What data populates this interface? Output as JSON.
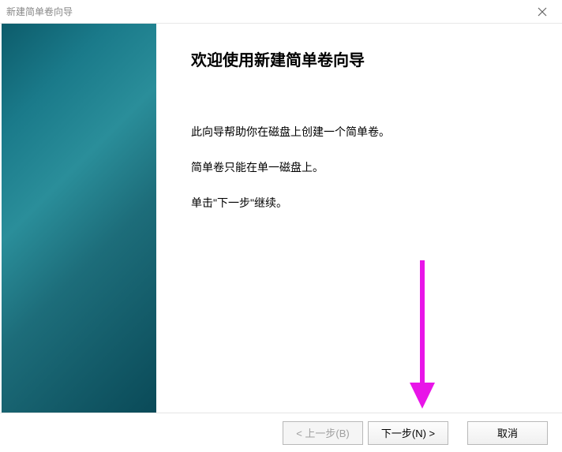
{
  "window": {
    "title": "新建简单卷向导"
  },
  "wizard": {
    "heading": "欢迎使用新建简单卷向导",
    "line1": "此向导帮助你在磁盘上创建一个简单卷。",
    "line2": "简单卷只能在单一磁盘上。",
    "line3": "单击\"下一步\"继续。"
  },
  "buttons": {
    "back": "< 上一步(B)",
    "next": "下一步(N) >",
    "cancel": "取消"
  },
  "annotation": {
    "arrow_color": "#e815e8"
  }
}
